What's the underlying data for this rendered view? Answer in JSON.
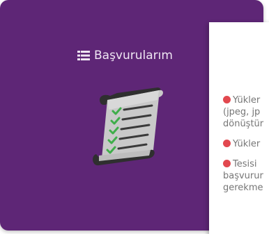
{
  "card": {
    "title": "Başvurularım",
    "title_icon": "list-icon",
    "illustration": "document-scroll-checklist-icon",
    "background_color": "#5e2676"
  },
  "panel": {
    "paragraphs": [
      {
        "bullet_color": "#e2484f",
        "lines": [
          "Yükler",
          "(jpeg, jp",
          "dönüştür"
        ]
      },
      {
        "bullet_color": "#e2484f",
        "lines": [
          "Yükler"
        ]
      },
      {
        "bullet_color": "#e2484f",
        "lines": [
          "Tesisi",
          "başvurur",
          "gerekme"
        ]
      }
    ]
  }
}
